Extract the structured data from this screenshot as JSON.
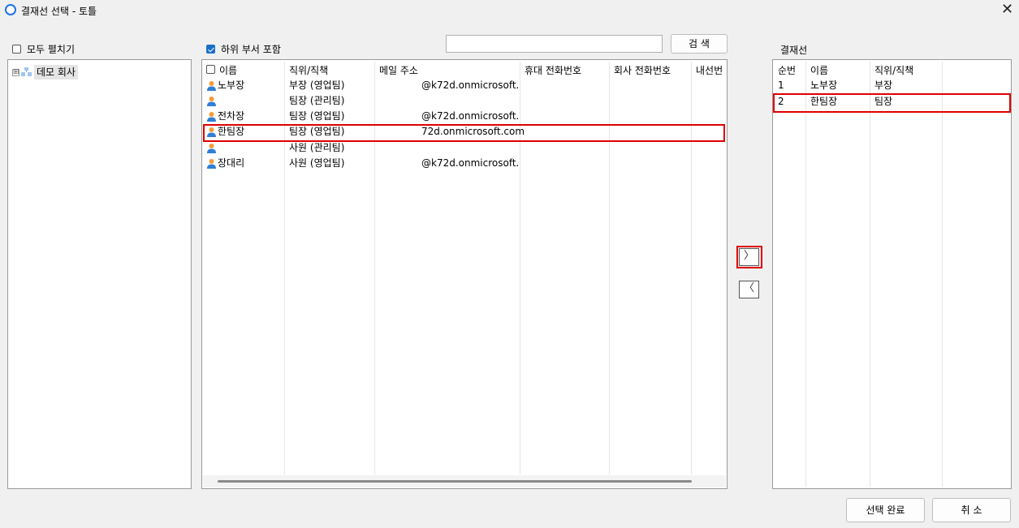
{
  "window": {
    "title": "결재선 선택 - 토틀",
    "close_glyph": "✕"
  },
  "left_panel": {
    "expand_all_label": "모두 펼치기",
    "expand_all_checked": false,
    "tree": [
      {
        "label": "데모 회사",
        "expander": "⊞"
      }
    ]
  },
  "middle_panel": {
    "include_sub_label": "하위 부서 포함",
    "include_sub_checked": true,
    "search_value": "",
    "search_button": "검 색",
    "columns": [
      "이름",
      "직위/직책",
      "메일 주소",
      "휴대 전화번호",
      "회사 전화번호",
      "내선번"
    ],
    "rows": [
      {
        "name": "노부장",
        "position": "부장 (영업팀)",
        "email": "@k72d.onmicrosoft....",
        "mobile": "",
        "office": ""
      },
      {
        "name": "",
        "position": "팀장 (관리팀)",
        "email": "",
        "mobile": "",
        "office": ""
      },
      {
        "name": "전차장",
        "position": "팀장 (영업팀)",
        "email": "@k72d.onmicrosoft....",
        "mobile": "",
        "office": ""
      },
      {
        "name": "한팀장",
        "position": "팀장 (영업팀)",
        "email": "72d.onmicrosoft.com",
        "mobile": "",
        "office": ""
      },
      {
        "name": "",
        "position": "사원 (관리팀)",
        "email": "",
        "mobile": "",
        "office": ""
      },
      {
        "name": "장대리",
        "position": "사원 (영업팀)",
        "email": "@k72d.onmicrosoft....",
        "mobile": "",
        "office": ""
      }
    ],
    "highlighted_row_index": 3
  },
  "transfer": {
    "add_glyph": "〉",
    "remove_glyph": "〈"
  },
  "right_panel": {
    "title": "결재선",
    "columns": [
      "순번",
      "이름",
      "직위/직책"
    ],
    "rows": [
      {
        "order": "1",
        "name": "노부장",
        "position": "부장"
      },
      {
        "order": "2",
        "name": "한팀장",
        "position": "팀장"
      }
    ],
    "highlighted_row_index": 1
  },
  "footer": {
    "confirm_button": "선택 완료",
    "cancel_button": "취 소"
  },
  "colors": {
    "highlight": "#e00000",
    "accent": "#1a6fc9",
    "person_head": "#f39c3c",
    "person_body": "#2f7fd6"
  }
}
